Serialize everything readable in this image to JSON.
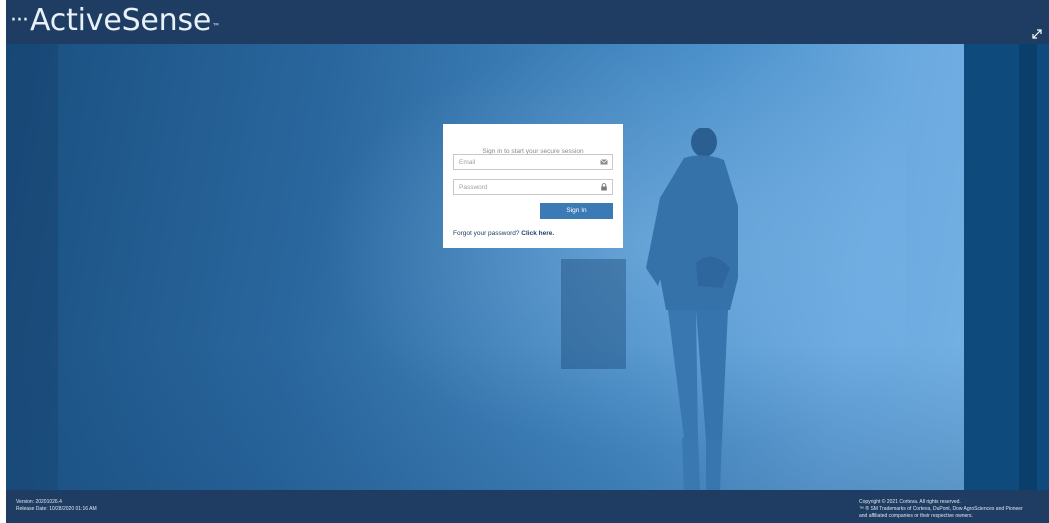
{
  "header": {
    "logo_dots": "···",
    "logo_text": "ActiveSense",
    "logo_tm": "™",
    "expand_icon": "expand-icon"
  },
  "login": {
    "title": "Sign in to start your secure session",
    "email_placeholder": "Email",
    "password_placeholder": "Password",
    "email_icon": "envelope-icon",
    "password_icon": "lock-icon",
    "signin_label": "Sign In",
    "forgot_text": "Forgot your password?",
    "forgot_link": "Click here."
  },
  "footer": {
    "version": "Version: 20201026.4",
    "release_date": "Release Date: 10/28/2020 01:16 AM",
    "copyright": "Copyright © 2021 Corteva. All rights reserved.",
    "trademarks": "™ ® SM Trademarks of Corteva, DuPont, Dow AgroSciences and Pioneer",
    "trademarks_cont": "and affiliated companies or their respective owners."
  },
  "colors": {
    "header_bg": "#1f3d63",
    "button_bg": "#3c7ab5",
    "hero_blue": "#4a8fc9"
  }
}
